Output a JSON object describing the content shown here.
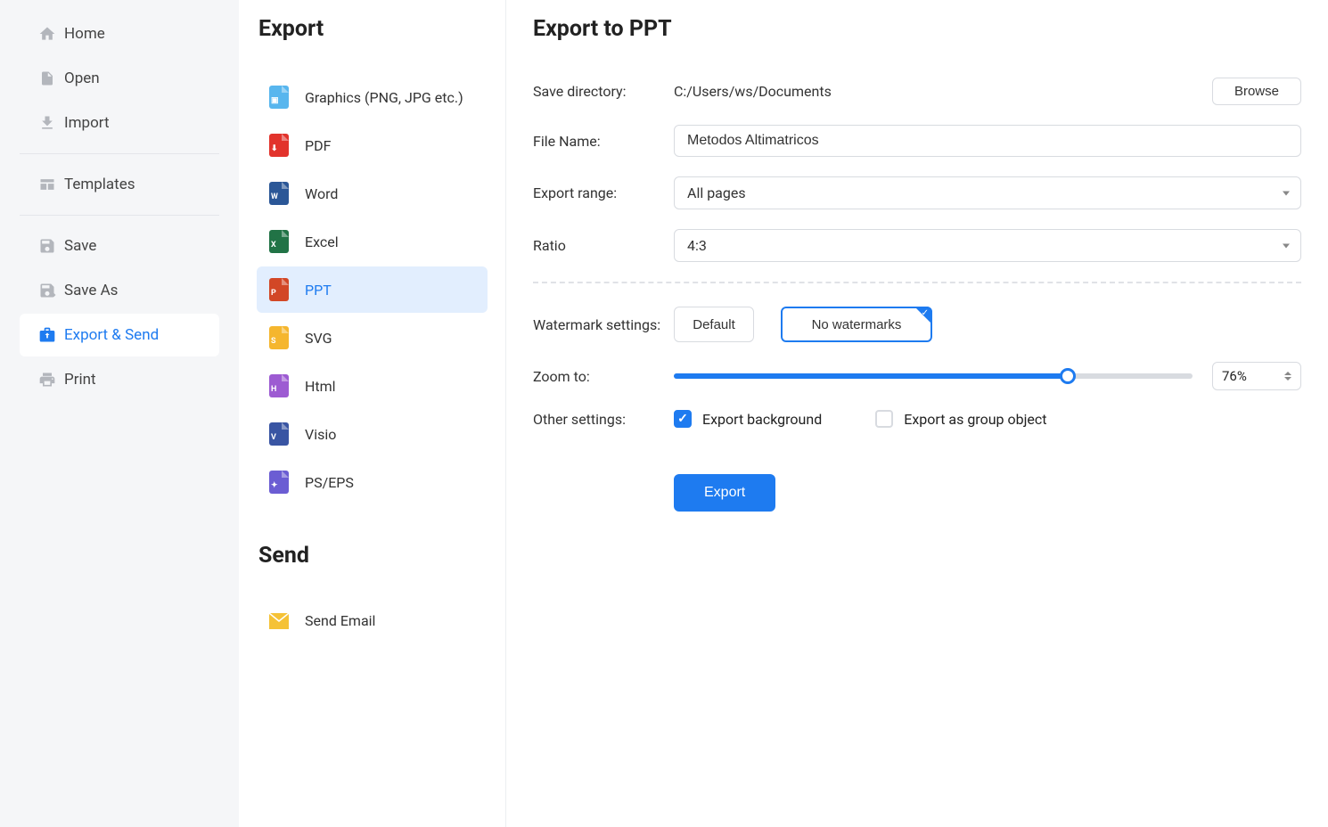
{
  "sidebar": {
    "items": [
      {
        "label": "Home",
        "icon": "home"
      },
      {
        "label": "Open",
        "icon": "page"
      },
      {
        "label": "Import",
        "icon": "download"
      },
      {
        "label": "Templates",
        "icon": "templates"
      },
      {
        "label": "Save",
        "icon": "save"
      },
      {
        "label": "Save As",
        "icon": "saveas"
      },
      {
        "label": "Export & Send",
        "icon": "export"
      },
      {
        "label": "Print",
        "icon": "print"
      }
    ]
  },
  "middle": {
    "export_h": "Export",
    "send_h": "Send",
    "formats": [
      {
        "label": "Graphics (PNG, JPG etc.)",
        "color": "#58b6ee"
      },
      {
        "label": "PDF",
        "color": "#e2332c"
      },
      {
        "label": "Word",
        "color": "#2b5797"
      },
      {
        "label": "Excel",
        "color": "#217346"
      },
      {
        "label": "PPT",
        "color": "#d24726"
      },
      {
        "label": "SVG",
        "color": "#f5b62e"
      },
      {
        "label": "Html",
        "color": "#9d5bd2"
      },
      {
        "label": "Visio",
        "color": "#3955a3"
      },
      {
        "label": "PS/EPS",
        "color": "#6b5dd3"
      }
    ],
    "send_items": [
      {
        "label": "Send Email",
        "color": "#f5c236"
      }
    ]
  },
  "main": {
    "title": "Export to PPT",
    "save_dir_label": "Save directory:",
    "save_dir_value": "C:/Users/ws/Documents",
    "browse_label": "Browse",
    "file_name_label": "File Name:",
    "file_name_value": "Metodos Altimatricos",
    "export_range_label": "Export range:",
    "export_range_value": "All pages",
    "ratio_label": "Ratio",
    "ratio_value": "4:3",
    "watermark_label": "Watermark settings:",
    "watermark_default": "Default",
    "watermark_none": "No watermarks",
    "zoom_label": "Zoom to:",
    "zoom_value": "76%",
    "other_label": "Other settings:",
    "bg_label": "Export background",
    "group_label": "Export as group object",
    "export_btn": "Export"
  }
}
